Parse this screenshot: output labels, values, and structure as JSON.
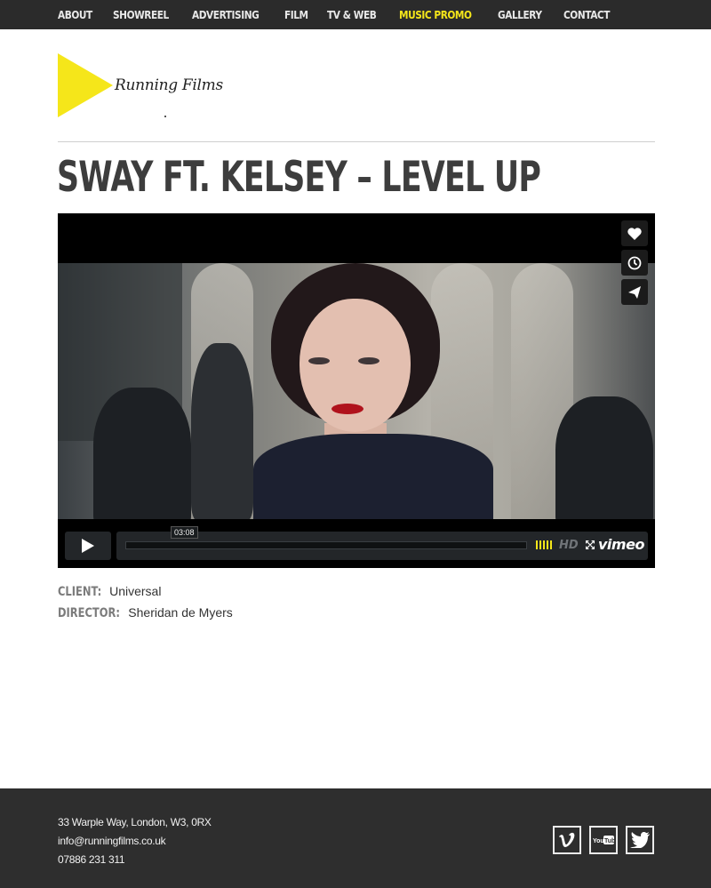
{
  "nav": {
    "items": [
      {
        "label": "ABOUT"
      },
      {
        "label": "SHOWREEL"
      },
      {
        "label": "ADVERTISING"
      },
      {
        "label": "FILM"
      },
      {
        "label": "TV & WEB"
      },
      {
        "label": "MUSIC PROMO",
        "active": true
      },
      {
        "label": "GALLERY"
      },
      {
        "label": "CONTACT"
      }
    ]
  },
  "logo": {
    "text": "Running Films",
    "color": "#f5e61a"
  },
  "page": {
    "title": "SWAY FT. KELSEY – LEVEL UP"
  },
  "video": {
    "time": "03:08",
    "hd_label": "HD",
    "brand": "vimeo",
    "side_icons": [
      "heart-icon",
      "clock-icon",
      "send-icon"
    ],
    "accent": "#f5e61a"
  },
  "meta": {
    "client_label": "CLIENT:",
    "client_value": "Universal",
    "director_label": "DIRECTOR:",
    "director_value": "Sheridan de Myers"
  },
  "footer": {
    "address": "33 Warple Way, London, W3, 0RX",
    "email": "info@runningfilms.co.uk",
    "phone": "07886 231 311",
    "social": [
      "vimeo-icon",
      "youtube-icon",
      "twitter-icon"
    ]
  }
}
